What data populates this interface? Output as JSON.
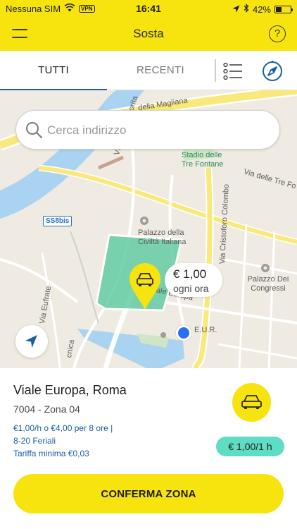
{
  "status_bar": {
    "carrier": "Nessuna SIM",
    "vpn": "VPN",
    "time": "16:41",
    "battery_percent_text": "42%",
    "battery_level": 0.42,
    "icons": [
      "wifi-icon",
      "location-arrow-icon",
      "bluetooth-icon",
      "battery-icon"
    ]
  },
  "header": {
    "title": "Sosta",
    "help_label": "?",
    "bg_color": "#f7e30d"
  },
  "tabs": {
    "all": "TUTTI",
    "recent": "RECENTI",
    "active": "all",
    "accent_color": "#1a5fa5"
  },
  "map": {
    "search_placeholder": "Cerca indirizzo",
    "labels": {
      "magliana": "della Magliana",
      "stadio": "Stadio delle Tre Fontane",
      "via_tre_fontane": "Via delle Tre Fo",
      "viale_val_fiorita": "Viale di Val Fiorita",
      "palazzo_civilta": "Palazzo della Civiltà Italiana",
      "via_cristoforo_colombo": "Via Cristoforo Colombo",
      "palazzo_congressi": "Palazzo Dei Congressi",
      "via_eufrate": "Via Eufrate",
      "viale_europa_map": "Viale Europa",
      "eur": "E.U.R.",
      "tecnica": "cnica"
    },
    "road_badge": "SS8bis",
    "bubble": {
      "price": "€ 1,00",
      "rate": "ogni ora"
    },
    "zone_color": "#56c89c"
  },
  "zone": {
    "address": "Viale Europa, Roma",
    "code": "7004 - Zona 04",
    "rules": [
      "€1,00/h o €4,00 per 8 ore |",
      "8-20 Feriali",
      "Tariffa minima €0,03"
    ],
    "rate_badge": "€ 1,00/1 h",
    "confirm_label": "CONFERMA ZONA"
  }
}
